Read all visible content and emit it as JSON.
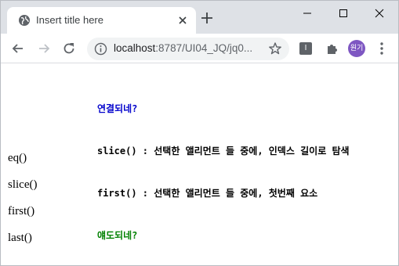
{
  "tab": {
    "title": "Insert title here"
  },
  "address_bar": {
    "host": "localhost",
    "rest": ":8787/UI04_JQ/jq0..."
  },
  "extension": {
    "label": "I"
  },
  "profile": {
    "initials": "원기",
    "color": "#7e57c2"
  },
  "content": {
    "lines": [
      {
        "text": "연결되네?",
        "color": "blue"
      },
      {
        "text": "slice() : 선택한 앨리먼트 들 중에, 인덱스 길이로 탐색",
        "color": "black"
      },
      {
        "text": "first() : 선택한 앨리먼트 들 중에, 첫번째 요소",
        "color": "black"
      },
      {
        "text": "얘도되네?",
        "color": "green"
      }
    ],
    "items": [
      "eq()",
      "slice()",
      "first()",
      "last()"
    ]
  }
}
